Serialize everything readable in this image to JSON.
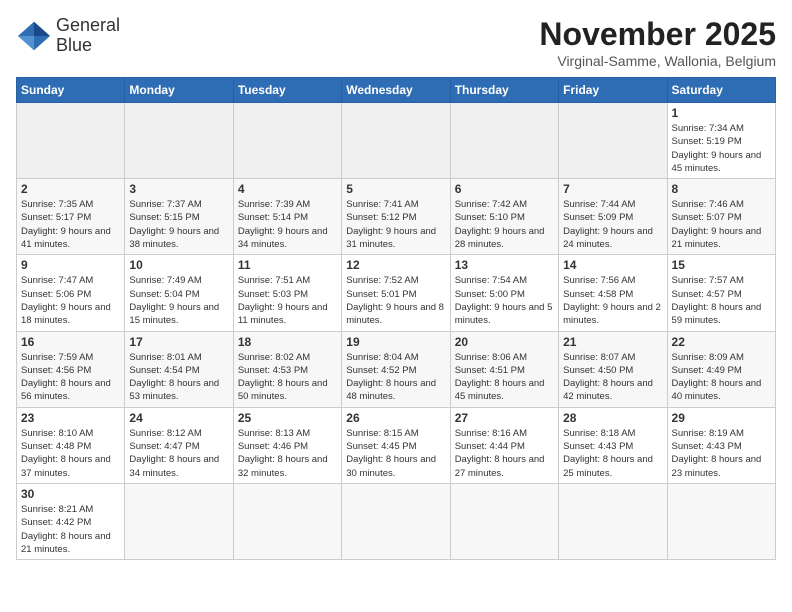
{
  "logo": {
    "line1": "General",
    "line2": "Blue"
  },
  "title": "November 2025",
  "subtitle": "Virginal-Samme, Wallonia, Belgium",
  "weekdays": [
    "Sunday",
    "Monday",
    "Tuesday",
    "Wednesday",
    "Thursday",
    "Friday",
    "Saturday"
  ],
  "weeks": [
    [
      {
        "day": "",
        "info": ""
      },
      {
        "day": "",
        "info": ""
      },
      {
        "day": "",
        "info": ""
      },
      {
        "day": "",
        "info": ""
      },
      {
        "day": "",
        "info": ""
      },
      {
        "day": "",
        "info": ""
      },
      {
        "day": "1",
        "info": "Sunrise: 7:34 AM\nSunset: 5:19 PM\nDaylight: 9 hours and 45 minutes."
      }
    ],
    [
      {
        "day": "2",
        "info": "Sunrise: 7:35 AM\nSunset: 5:17 PM\nDaylight: 9 hours and 41 minutes."
      },
      {
        "day": "3",
        "info": "Sunrise: 7:37 AM\nSunset: 5:15 PM\nDaylight: 9 hours and 38 minutes."
      },
      {
        "day": "4",
        "info": "Sunrise: 7:39 AM\nSunset: 5:14 PM\nDaylight: 9 hours and 34 minutes."
      },
      {
        "day": "5",
        "info": "Sunrise: 7:41 AM\nSunset: 5:12 PM\nDaylight: 9 hours and 31 minutes."
      },
      {
        "day": "6",
        "info": "Sunrise: 7:42 AM\nSunset: 5:10 PM\nDaylight: 9 hours and 28 minutes."
      },
      {
        "day": "7",
        "info": "Sunrise: 7:44 AM\nSunset: 5:09 PM\nDaylight: 9 hours and 24 minutes."
      },
      {
        "day": "8",
        "info": "Sunrise: 7:46 AM\nSunset: 5:07 PM\nDaylight: 9 hours and 21 minutes."
      }
    ],
    [
      {
        "day": "9",
        "info": "Sunrise: 7:47 AM\nSunset: 5:06 PM\nDaylight: 9 hours and 18 minutes."
      },
      {
        "day": "10",
        "info": "Sunrise: 7:49 AM\nSunset: 5:04 PM\nDaylight: 9 hours and 15 minutes."
      },
      {
        "day": "11",
        "info": "Sunrise: 7:51 AM\nSunset: 5:03 PM\nDaylight: 9 hours and 11 minutes."
      },
      {
        "day": "12",
        "info": "Sunrise: 7:52 AM\nSunset: 5:01 PM\nDaylight: 9 hours and 8 minutes."
      },
      {
        "day": "13",
        "info": "Sunrise: 7:54 AM\nSunset: 5:00 PM\nDaylight: 9 hours and 5 minutes."
      },
      {
        "day": "14",
        "info": "Sunrise: 7:56 AM\nSunset: 4:58 PM\nDaylight: 9 hours and 2 minutes."
      },
      {
        "day": "15",
        "info": "Sunrise: 7:57 AM\nSunset: 4:57 PM\nDaylight: 8 hours and 59 minutes."
      }
    ],
    [
      {
        "day": "16",
        "info": "Sunrise: 7:59 AM\nSunset: 4:56 PM\nDaylight: 8 hours and 56 minutes."
      },
      {
        "day": "17",
        "info": "Sunrise: 8:01 AM\nSunset: 4:54 PM\nDaylight: 8 hours and 53 minutes."
      },
      {
        "day": "18",
        "info": "Sunrise: 8:02 AM\nSunset: 4:53 PM\nDaylight: 8 hours and 50 minutes."
      },
      {
        "day": "19",
        "info": "Sunrise: 8:04 AM\nSunset: 4:52 PM\nDaylight: 8 hours and 48 minutes."
      },
      {
        "day": "20",
        "info": "Sunrise: 8:06 AM\nSunset: 4:51 PM\nDaylight: 8 hours and 45 minutes."
      },
      {
        "day": "21",
        "info": "Sunrise: 8:07 AM\nSunset: 4:50 PM\nDaylight: 8 hours and 42 minutes."
      },
      {
        "day": "22",
        "info": "Sunrise: 8:09 AM\nSunset: 4:49 PM\nDaylight: 8 hours and 40 minutes."
      }
    ],
    [
      {
        "day": "23",
        "info": "Sunrise: 8:10 AM\nSunset: 4:48 PM\nDaylight: 8 hours and 37 minutes."
      },
      {
        "day": "24",
        "info": "Sunrise: 8:12 AM\nSunset: 4:47 PM\nDaylight: 8 hours and 34 minutes."
      },
      {
        "day": "25",
        "info": "Sunrise: 8:13 AM\nSunset: 4:46 PM\nDaylight: 8 hours and 32 minutes."
      },
      {
        "day": "26",
        "info": "Sunrise: 8:15 AM\nSunset: 4:45 PM\nDaylight: 8 hours and 30 minutes."
      },
      {
        "day": "27",
        "info": "Sunrise: 8:16 AM\nSunset: 4:44 PM\nDaylight: 8 hours and 27 minutes."
      },
      {
        "day": "28",
        "info": "Sunrise: 8:18 AM\nSunset: 4:43 PM\nDaylight: 8 hours and 25 minutes."
      },
      {
        "day": "29",
        "info": "Sunrise: 8:19 AM\nSunset: 4:43 PM\nDaylight: 8 hours and 23 minutes."
      }
    ],
    [
      {
        "day": "30",
        "info": "Sunrise: 8:21 AM\nSunset: 4:42 PM\nDaylight: 8 hours and 21 minutes."
      },
      {
        "day": "",
        "info": ""
      },
      {
        "day": "",
        "info": ""
      },
      {
        "day": "",
        "info": ""
      },
      {
        "day": "",
        "info": ""
      },
      {
        "day": "",
        "info": ""
      },
      {
        "day": "",
        "info": ""
      }
    ]
  ]
}
